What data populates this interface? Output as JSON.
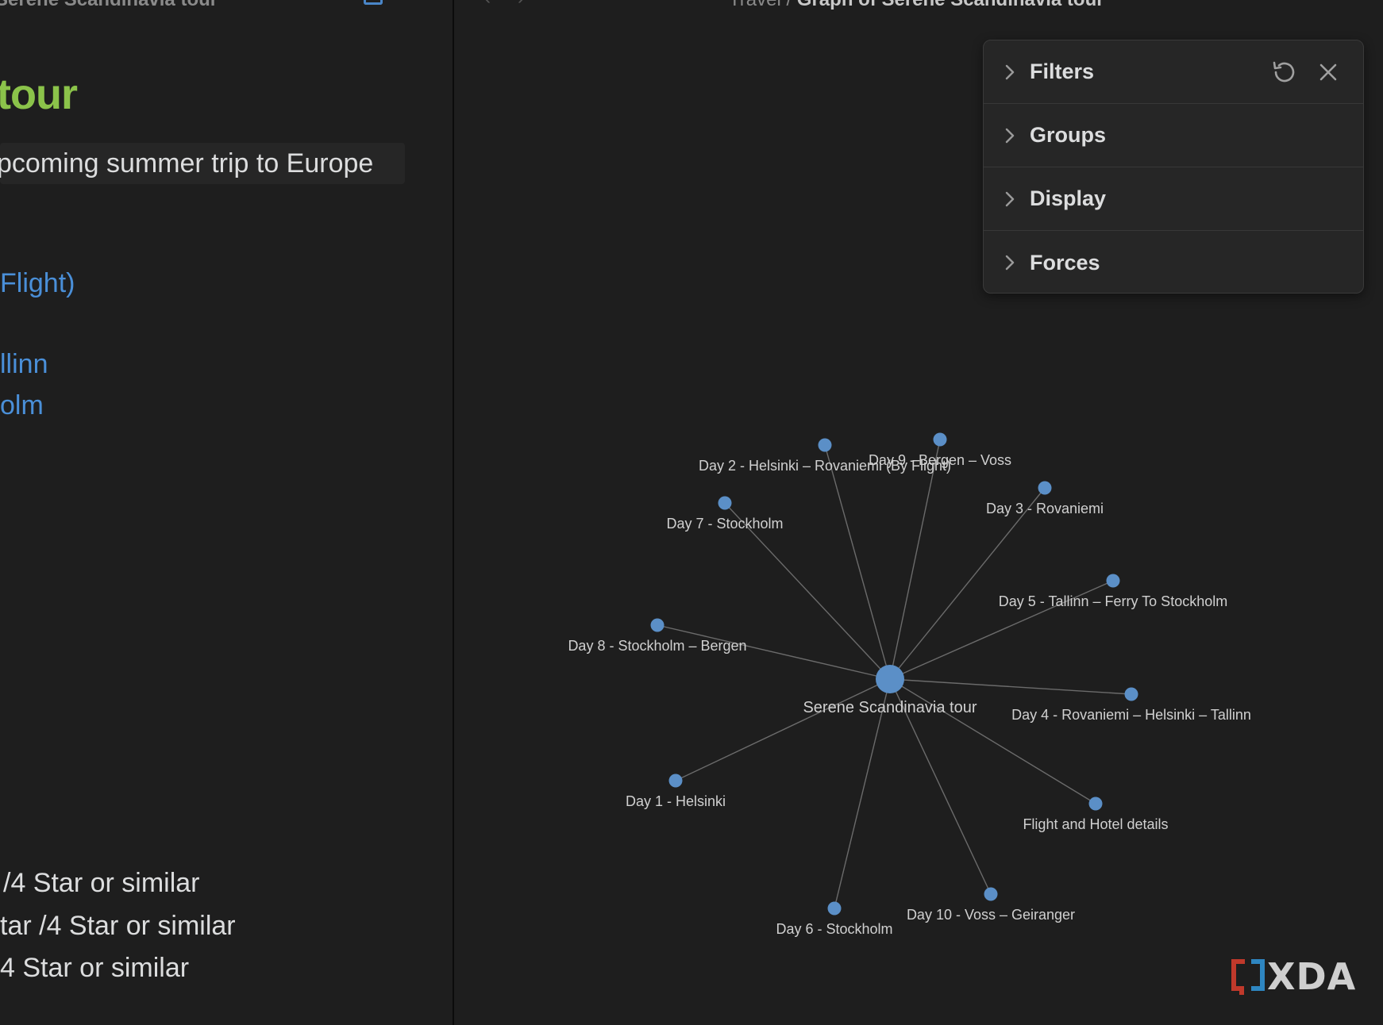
{
  "editor": {
    "tab_title": "Serene Scandinavia tour",
    "title": "tour",
    "subtitle": "pcoming summer trip to Europe",
    "links": [
      "Flight)",
      "llinn",
      "olm"
    ],
    "lines": [
      "/4 Star or similar",
      "tar /4 Star or similar",
      "4 Star or similar"
    ]
  },
  "graph_view": {
    "breadcrumb_parent": "Travel /",
    "breadcrumb_current": "Graph of Serene Scandinavia tour",
    "nav_back": "‹",
    "nav_forward": "›",
    "node_color": "#5b8fc7",
    "link_color": "#6b6b6b",
    "center_node": "Serene Scandinavia tour",
    "nodes": [
      {
        "label": "Day 2 - Helsinki – Rovaniemi (By Flight)"
      },
      {
        "label": "Day 9 - Bergen – Voss"
      },
      {
        "label": "Day 3 - Rovaniemi"
      },
      {
        "label": "Day 7 - Stockholm"
      },
      {
        "label": "Day 5 - Tallinn – Ferry To Stockholm"
      },
      {
        "label": "Day 8 - Stockholm – Bergen"
      },
      {
        "label": "Day 4 - Rovaniemi – Helsinki – Tallinn"
      },
      {
        "label": "Day 1 - Helsinki"
      },
      {
        "label": "Flight and Hotel details"
      },
      {
        "label": "Day 10 - Voss – Geiranger"
      },
      {
        "label": "Day 6 - Stockholm"
      }
    ]
  },
  "controls": {
    "items": [
      {
        "label": "Filters",
        "icon": "chevron-right-icon"
      },
      {
        "label": "Groups",
        "icon": "chevron-right-icon"
      },
      {
        "label": "Display",
        "icon": "chevron-right-icon"
      },
      {
        "label": "Forces",
        "icon": "chevron-right-icon"
      }
    ],
    "restore_icon": "restore-icon",
    "close_icon": "close-icon"
  },
  "watermark": {
    "text": "XDA",
    "accent_colors": [
      "#c0392b",
      "#2e86c1"
    ]
  }
}
